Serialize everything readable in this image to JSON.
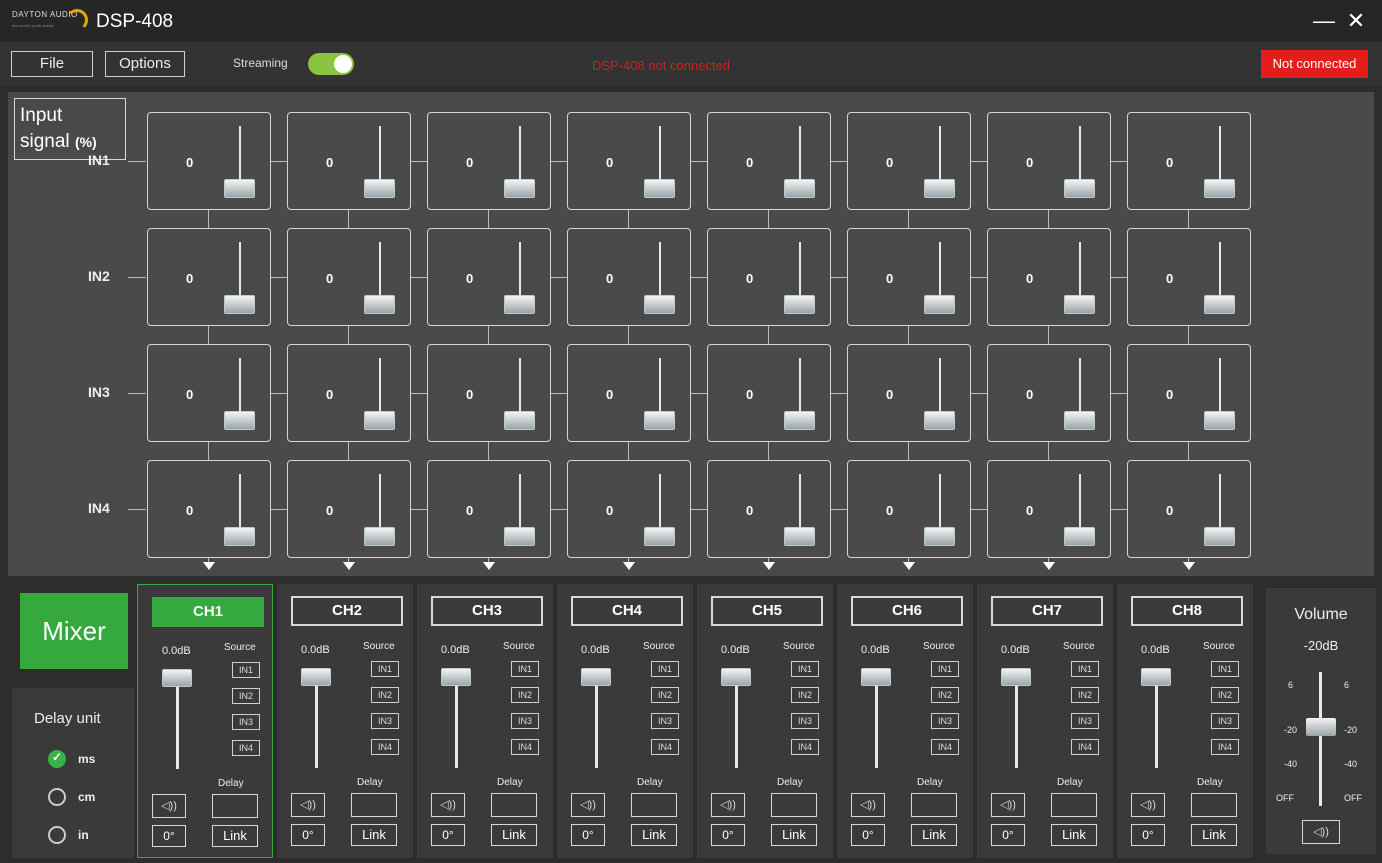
{
  "app": {
    "logo": "DAYTON AUDIO",
    "logo_tagline": "the world's audio leader",
    "title": "DSP-408",
    "minimize_icon": "minimize-icon",
    "close_icon": "close-icon"
  },
  "menu": {
    "file": "File",
    "options": "Options",
    "streaming_label": "Streaming",
    "streaming_on": true
  },
  "status": {
    "message": "DSP-408 not connected",
    "badge": "Not connected",
    "badge_color": "#e41d1d",
    "message_color": "#d11f1f"
  },
  "matrix": {
    "input_title": "Input",
    "input_title2": "signal",
    "input_unit": "(%)",
    "rows": [
      "IN1",
      "IN2",
      "IN3",
      "IN4"
    ],
    "values": [
      [
        "0",
        "0",
        "0",
        "0",
        "0",
        "0",
        "0",
        "0"
      ],
      [
        "0",
        "0",
        "0",
        "0",
        "0",
        "0",
        "0",
        "0"
      ],
      [
        "0",
        "0",
        "0",
        "0",
        "0",
        "0",
        "0",
        "0"
      ],
      [
        "0",
        "0",
        "0",
        "0",
        "0",
        "0",
        "0",
        "0"
      ]
    ]
  },
  "mixer": {
    "label": "Mixer",
    "accent": "#35a83e"
  },
  "delay_unit": {
    "title": "Delay unit",
    "options": [
      {
        "label": "ms",
        "selected": true
      },
      {
        "label": "cm",
        "selected": false
      },
      {
        "label": "in",
        "selected": false
      }
    ]
  },
  "channels": [
    {
      "name": "CH1",
      "gain": "0.0dB",
      "source_label": "Source",
      "sources": [
        "IN1",
        "IN2",
        "IN3",
        "IN4"
      ],
      "delay_label": "Delay",
      "phase": "0°",
      "link": "Link",
      "active": true
    },
    {
      "name": "CH2",
      "gain": "0.0dB",
      "source_label": "Source",
      "sources": [
        "IN1",
        "IN2",
        "IN3",
        "IN4"
      ],
      "delay_label": "Delay",
      "phase": "0°",
      "link": "Link",
      "active": false
    },
    {
      "name": "CH3",
      "gain": "0.0dB",
      "source_label": "Source",
      "sources": [
        "IN1",
        "IN2",
        "IN3",
        "IN4"
      ],
      "delay_label": "Delay",
      "phase": "0°",
      "link": "Link",
      "active": false
    },
    {
      "name": "CH4",
      "gain": "0.0dB",
      "source_label": "Source",
      "sources": [
        "IN1",
        "IN2",
        "IN3",
        "IN4"
      ],
      "delay_label": "Delay",
      "phase": "0°",
      "link": "Link",
      "active": false
    },
    {
      "name": "CH5",
      "gain": "0.0dB",
      "source_label": "Source",
      "sources": [
        "IN1",
        "IN2",
        "IN3",
        "IN4"
      ],
      "delay_label": "Delay",
      "phase": "0°",
      "link": "Link",
      "active": false
    },
    {
      "name": "CH6",
      "gain": "0.0dB",
      "source_label": "Source",
      "sources": [
        "IN1",
        "IN2",
        "IN3",
        "IN4"
      ],
      "delay_label": "Delay",
      "phase": "0°",
      "link": "Link",
      "active": false
    },
    {
      "name": "CH7",
      "gain": "0.0dB",
      "source_label": "Source",
      "sources": [
        "IN1",
        "IN2",
        "IN3",
        "IN4"
      ],
      "delay_label": "Delay",
      "phase": "0°",
      "link": "Link",
      "active": false
    },
    {
      "name": "CH8",
      "gain": "0.0dB",
      "source_label": "Source",
      "sources": [
        "IN1",
        "IN2",
        "IN3",
        "IN4"
      ],
      "delay_label": "Delay",
      "phase": "0°",
      "link": "Link",
      "active": false
    }
  ],
  "volume": {
    "title": "Volume",
    "value": "-20dB",
    "scale_left": [
      "6",
      "-20",
      "-40",
      "OFF"
    ],
    "scale_right": [
      "6",
      "-20",
      "-40",
      "OFF"
    ]
  },
  "icons": {
    "speaker": "speaker-icon",
    "speaker_glyph": "◁))"
  }
}
